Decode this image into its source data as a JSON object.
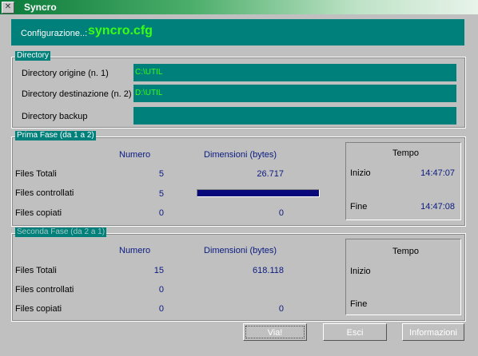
{
  "window": {
    "title": "Syncro",
    "system_icon": "close-x-icon"
  },
  "config": {
    "label": "Configurazione..:",
    "value": "syncro.cfg"
  },
  "directory": {
    "legend": "Directory",
    "origin_label": "Directory origine (n. 1)",
    "origin_value": "C:\\UTIL",
    "dest_label": "Directory destinazione (n. 2)",
    "dest_value": "D:\\UTIL",
    "backup_label": "Directory backup",
    "backup_value": ""
  },
  "phase1": {
    "legend": "Prima Fase (da 1 a 2)",
    "col_numero": "Numero",
    "col_dim": "Dimensioni (bytes)",
    "row_totali": "Files Totali",
    "row_controllati": "Files controllati",
    "row_copiati": "Files copiati",
    "totali_num": "5",
    "totali_dim": "26.717",
    "controllati_num": "5",
    "progress": 1.0,
    "copiati_num": "0",
    "copiati_dim": "0",
    "tempo_title": "Tempo",
    "inizio_label": "Inizio",
    "inizio_value": "14:47:07",
    "fine_label": "Fine",
    "fine_value": "14:47:08"
  },
  "phase2": {
    "legend": "Seconda Fase (da 2 a 1)",
    "col_numero": "Numero",
    "col_dim": "Dimensioni (bytes)",
    "row_totali": "Files Totali",
    "row_controllati": "Files controllati",
    "row_copiati": "Files copiati",
    "totali_num": "15",
    "totali_dim": "618.118",
    "controllati_num": "0",
    "copiati_num": "0",
    "copiati_dim": "0",
    "tempo_title": "Tempo",
    "inizio_label": "Inizio",
    "fine_label": "Fine"
  },
  "buttons": {
    "via": "Via!",
    "esci": "Esci",
    "informazioni": "Informazioni"
  },
  "colors": {
    "teal": "#00807a",
    "value_green": "#39ff14",
    "number_blue": "#0a1a80"
  }
}
